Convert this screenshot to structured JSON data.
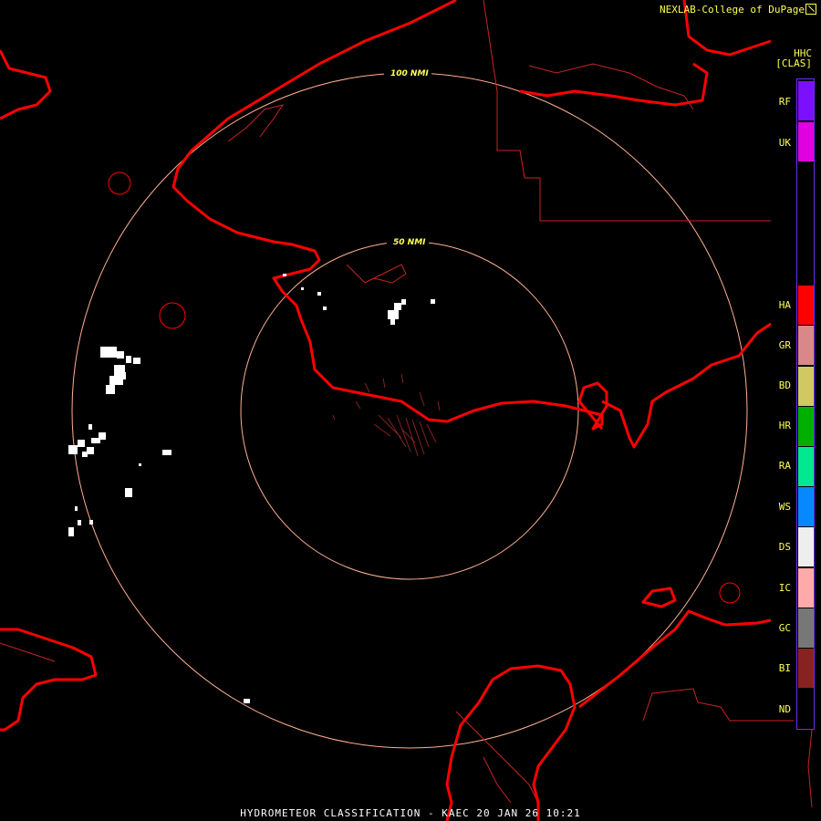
{
  "header": {
    "credit": "NEXLAB-College of DuPage",
    "product": "HHC",
    "units": "[CLAS]"
  },
  "range_rings": [
    {
      "label": "50 NMI"
    },
    {
      "label": "100 NMI"
    }
  ],
  "legend": {
    "items": [
      {
        "code": "RF",
        "color": "#7a10ff"
      },
      {
        "code": "UK",
        "color": "#e000e0"
      },
      {
        "code": "HA",
        "color": "#ff0000"
      },
      {
        "code": "GR",
        "color": "#d88888"
      },
      {
        "code": "BD",
        "color": "#d0c860"
      },
      {
        "code": "HR",
        "color": "#00b000"
      },
      {
        "code": "RA",
        "color": "#00e890"
      },
      {
        "code": "WS",
        "color": "#0888ff"
      },
      {
        "code": "DS",
        "color": "#eeeeee"
      },
      {
        "code": "IC",
        "color": "#ffaaaa"
      },
      {
        "code": "GC",
        "color": "#777777"
      },
      {
        "code": "BI",
        "color": "#882222"
      },
      {
        "code": "ND",
        "color": "#000000"
      }
    ]
  },
  "colors": {
    "coastline": "#ff0000",
    "boundary": "#cc2222",
    "ring": "#ffb090",
    "legend_text": "#ffff55",
    "echo": "#ffffff"
  },
  "footer": {
    "title": "HYDROMETEOR CLASSIFICATION - KAEC 20 JAN 26 10:21"
  }
}
